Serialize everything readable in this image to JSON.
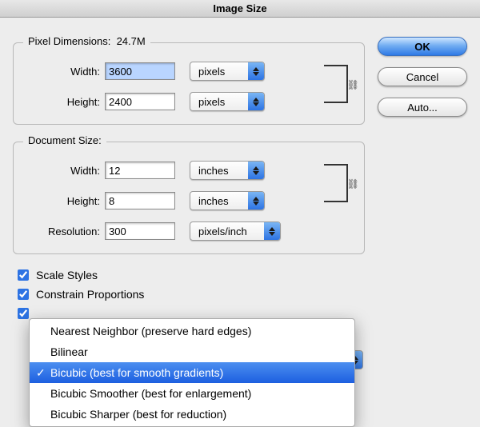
{
  "title": "Image Size",
  "buttons": {
    "ok": "OK",
    "cancel": "Cancel",
    "auto": "Auto..."
  },
  "pixelDimensions": {
    "legendPrefix": "Pixel Dimensions:",
    "size": "24.7M",
    "widthLabel": "Width:",
    "widthValue": "3600",
    "widthUnit": "pixels",
    "heightLabel": "Height:",
    "heightValue": "2400",
    "heightUnit": "pixels"
  },
  "documentSize": {
    "legend": "Document Size:",
    "widthLabel": "Width:",
    "widthValue": "12",
    "widthUnit": "inches",
    "heightLabel": "Height:",
    "heightValue": "8",
    "heightUnit": "inches",
    "resolutionLabel": "Resolution:",
    "resolutionValue": "300",
    "resolutionUnit": "pixels/inch"
  },
  "checks": {
    "scaleStyles": "Scale Styles",
    "constrainProportions": "Constrain Proportions"
  },
  "interpolation": {
    "items": [
      "Nearest Neighbor (preserve hard edges)",
      "Bilinear",
      "Bicubic (best for smooth gradients)",
      "Bicubic Smoother (best for enlargement)",
      "Bicubic Sharper (best for reduction)"
    ],
    "selectedIndex": 2,
    "checkmark": "✓"
  }
}
